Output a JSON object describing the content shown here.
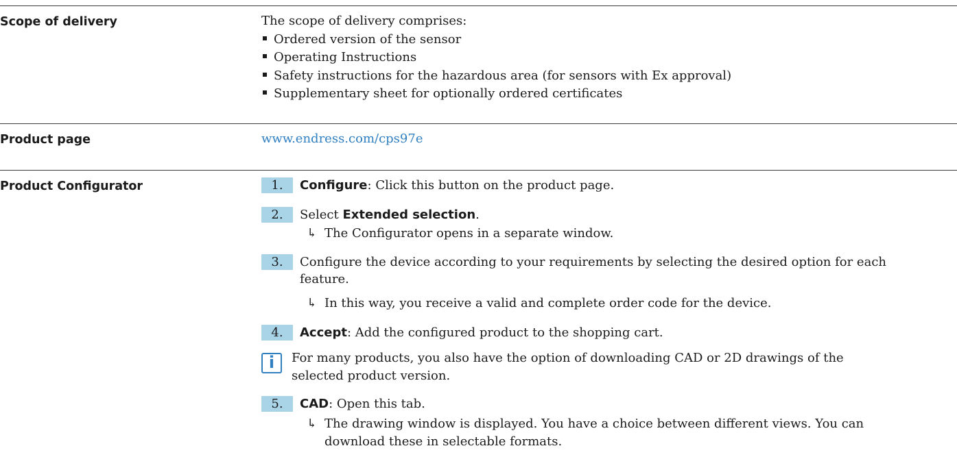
{
  "scope": {
    "label": "Scope of delivery",
    "intro": "The scope of delivery comprises:",
    "items": [
      "Ordered version of the sensor",
      "Operating Instructions",
      "Safety instructions for the hazardous area (for sensors with Ex approval)",
      "Supplementary sheet for optionally ordered certificates"
    ]
  },
  "product_page": {
    "label": "Product page",
    "link": "www.endress.com/cps97e"
  },
  "configurator": {
    "label": "Product Configurator",
    "steps": [
      {
        "num": "1.",
        "bold": "Configure",
        "text": ": Click this button on the product page."
      },
      {
        "num": "2.",
        "pre": "Select ",
        "bold": "Extended selection",
        "text": "."
      },
      {
        "num": "3.",
        "text1": "Configure the device according to your requirements by selecting the desired option for each",
        "text2": "feature."
      },
      {
        "num": "4.",
        "bold": "Accept",
        "text": ": Add the configured product to the shopping cart."
      },
      {
        "num": "5.",
        "bold": "CAD",
        "text": ": Open this tab."
      }
    ],
    "results": [
      "The Configurator opens in a separate window.",
      "In this way, you receive a valid and complete order code for the device.",
      "The drawing window is displayed. You have a choice between different views. You can",
      "download these in selectable formats."
    ],
    "note_line1": "For many products, you also have the option of downloading CAD or 2D drawings of the",
    "note_line2": "selected product version.",
    "note_icon": "info-icon",
    "arrow_glyph": "↳"
  }
}
